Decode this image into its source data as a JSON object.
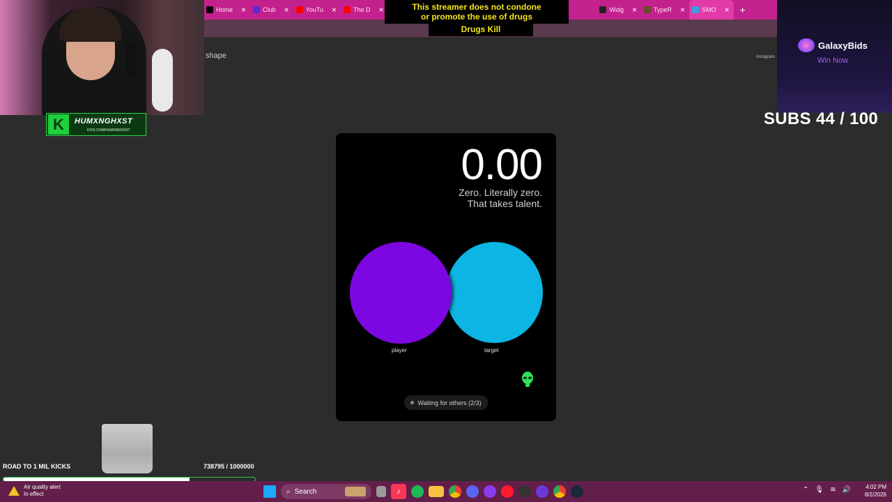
{
  "browser": {
    "tabs": [
      {
        "label": "Home",
        "color": "#000000"
      },
      {
        "label": "Club",
        "color": "#5a2bd1"
      },
      {
        "label": "YouTu",
        "color": "#ff0000"
      },
      {
        "label": "The D",
        "color": "#ff0000"
      },
      {
        "label": "Widg",
        "color": "#222222"
      },
      {
        "label": "TypeR",
        "color": "#6b4b2a"
      },
      {
        "label": "SMO",
        "color": "#35a0e0"
      }
    ],
    "close_glyph": "×",
    "new_tab_glyph": "+"
  },
  "overlay": {
    "warning_line1": "This streamer does not condone",
    "warning_line2": "or promote the use of drugs",
    "warning_line3": "Drugs Kill",
    "badge_name": "HUMXNGHXST",
    "badge_url": "KICK.COM/HUMXNGHXST",
    "sponsor_name": "GalaxyBids",
    "sponsor_cta": "Win Now",
    "subs": "SUBS 44 / 100",
    "road_label": "ROAD TO 1 MIL KICKS",
    "kicks_count": "738795 / 1000000",
    "kicks_progress": 0.738795
  },
  "page": {
    "shape_label": "shape",
    "instagram": "Instagram"
  },
  "game": {
    "score": "0.00",
    "message_line1": "Zero. Literally zero.",
    "message_line2": "That takes talent.",
    "player_label": "player",
    "target_label": "target",
    "status": "Waiting for others (2/3)",
    "player_color": "#7c07e0",
    "target_color": "#0cb5e4"
  },
  "taskbar": {
    "alert_title": "Air quality alert",
    "alert_sub": "In effect",
    "search_placeholder": "Search",
    "time": "4:02 PM",
    "date": "8/2/2026"
  }
}
